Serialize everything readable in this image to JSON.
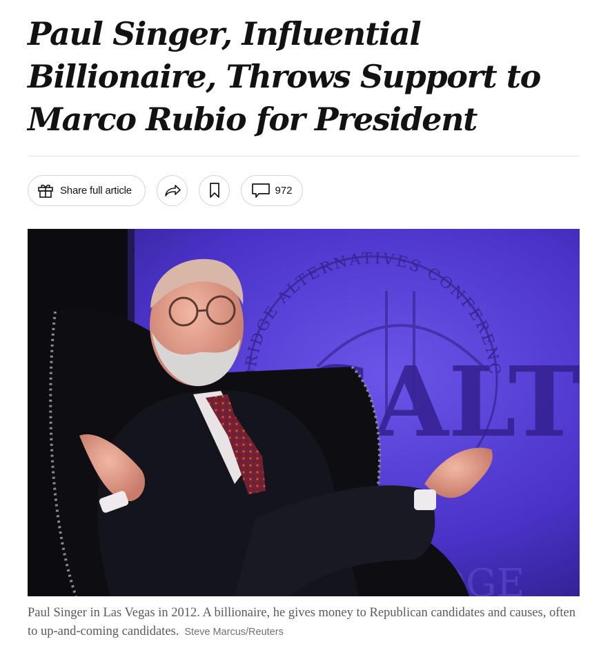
{
  "article": {
    "headline": "Paul Singer, Influential Billionaire, Throws Support to Marco Rubio for President"
  },
  "toolbar": {
    "share_label": "Share full article",
    "comment_count": "972",
    "icons": [
      "gift-icon",
      "share-arrow-icon",
      "bookmark-icon",
      "comment-icon"
    ]
  },
  "photo": {
    "backdrop_text_top": "BRIDGE ALTERNATIVES CONFERENCE",
    "backdrop_text_logo": "SALT",
    "backdrop_text_bottom": "DGE",
    "backdrop_color": "#4b33c9"
  },
  "caption": {
    "text": "Paul Singer in Las Vegas in 2012. A billionaire, he gives money to Republican candidates and causes, often to up-and-coming candidates.",
    "credit": "Steve Marcus/Reuters"
  }
}
